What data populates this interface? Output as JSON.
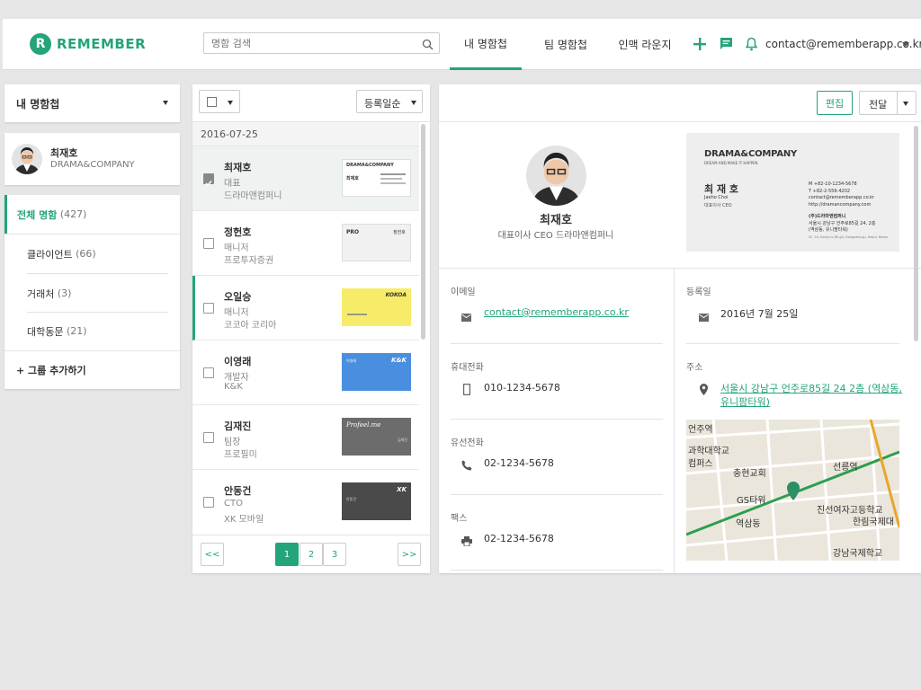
{
  "app": {
    "logo_letter": "R",
    "name": "REMEMBER",
    "accent": "#23a47a"
  },
  "header": {
    "search_placeholder": "명함 검색",
    "tabs": [
      {
        "label": "내 명함첩",
        "active": true
      },
      {
        "label": "팀 명함첩",
        "active": false
      },
      {
        "label": "인맥 라운지",
        "active": false
      }
    ],
    "user_email": "contact@rememberapp.co.kr"
  },
  "sidebar": {
    "dropdown_label": "내 명함첩",
    "profile": {
      "name": "최재호",
      "company": "DRAMA&COMPANY"
    },
    "groups": [
      {
        "label": "전체 명함",
        "count": "(427)",
        "active": true
      },
      {
        "label": "클라이언트",
        "count": "(66)",
        "active": false
      },
      {
        "label": "거래처",
        "count": "(3)",
        "active": false
      },
      {
        "label": "대학동문",
        "count": "(21)",
        "active": false
      }
    ],
    "add_group": "+ 그룹 추가하기"
  },
  "list": {
    "sort_label": "등록일순",
    "date_header": "2016-07-25",
    "rows": [
      {
        "name": "최재호",
        "title": "대표",
        "company": "드라마앤컴퍼니",
        "checked": true,
        "selected": true,
        "card": {
          "bg": "#ffffff",
          "brand": "DRAMA&COMPANY",
          "name": "최재호"
        }
      },
      {
        "name": "정헌호",
        "title": "매니저",
        "company": "프로투자증권",
        "checked": false,
        "selected": false,
        "card": {
          "bg": "#f1f1f1",
          "brand": "PRO",
          "name": "정헌호"
        }
      },
      {
        "name": "오일승",
        "title": "매니저",
        "company": "코코아 코리아",
        "checked": false,
        "selected": false,
        "card": {
          "bg": "#f7ec6a",
          "brand": "KOKOA",
          "name": ""
        }
      },
      {
        "name": "이영래",
        "title": "개발자",
        "company": "K&K",
        "checked": false,
        "selected": false,
        "card": {
          "bg": "#4a8ee0",
          "brand": "K&K",
          "name": "이영래"
        }
      },
      {
        "name": "김재진",
        "title": "팀장",
        "company": "프로필미",
        "checked": false,
        "selected": false,
        "card": {
          "bg": "#6c6c6c",
          "brand": "Profeel.me",
          "name": "김재진"
        }
      },
      {
        "name": "안동건",
        "title": "CTO",
        "company": "XK 모바일",
        "checked": false,
        "selected": false,
        "card": {
          "bg": "#4a4a4a",
          "brand": "XK",
          "name": "안동건"
        }
      }
    ],
    "pagination": {
      "prev": "<<",
      "pages": [
        "1",
        "2",
        "3"
      ],
      "current": "1",
      "next": ">>"
    }
  },
  "detail": {
    "edit_button": "편집",
    "forward_button": "전달",
    "name": "최재호",
    "subtitle": "대표이사 CEO 드라마앤컴퍼니",
    "card": {
      "brand": "DRAMA&COMPANY",
      "tagline": "DREAM AND MAKE IT HAPPEN",
      "name_ko": "최 재 호",
      "name_en": "Jaeho Choi",
      "role": "대표이사 CEO",
      "mobile": "M  +82-10-1234-5678",
      "tel": "T  +82-2-556-4202",
      "email": "contact@rememberapp.co.kr",
      "web": "http://dramancompany.com",
      "company_ko": "(주)드라마앤컴퍼니",
      "addr1": "서울시 강남구 언주로85길 24, 2층",
      "addr2": "(역삼동, 유니팜타워)",
      "addr_en": "2F, 24, Eonju-ro 85-gil, Gangnam-gu, Seoul, Korea"
    },
    "fields": {
      "email_label": "이메일",
      "email": "contact@rememberapp.co.kr",
      "mobile_label": "휴대전화",
      "mobile": "010-1234-5678",
      "phone_label": "유선전화",
      "phone": "02-1234-5678",
      "fax_label": "팩스",
      "fax": "02-1234-5678",
      "date_label": "등록일",
      "date": "2016년 7월 25일",
      "address_label": "주소",
      "address_line1": "서울시 강남구 언주로85길 24 2층 (역삼동,",
      "address_line2": "유니팜타워)"
    },
    "map": {
      "labels": [
        "언주역",
        "과학대학교",
        "컴퍼스",
        "충현교회",
        "선릉역",
        "GS타워",
        "역삼동",
        "진선여자고등학교",
        "한림국제대",
        "강남국제학교"
      ]
    }
  }
}
